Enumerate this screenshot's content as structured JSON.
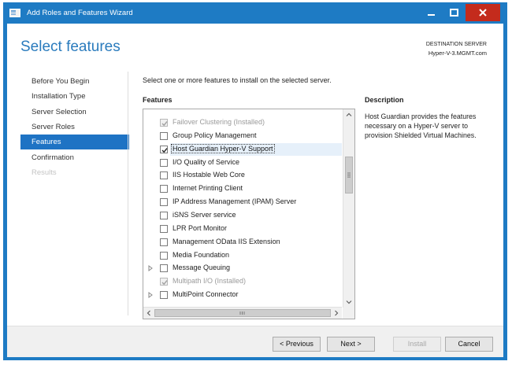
{
  "window": {
    "title": "Add Roles and Features Wizard",
    "accent_color": "#1e7bc4",
    "close_color": "#c42b1c"
  },
  "header": {
    "heading": "Select features",
    "destination_label": "DESTINATION SERVER",
    "destination_value": "Hyper-V-3.MGMT.com"
  },
  "nav": {
    "items": [
      {
        "label": "Before You Begin",
        "state": "normal"
      },
      {
        "label": "Installation Type",
        "state": "normal"
      },
      {
        "label": "Server Selection",
        "state": "normal"
      },
      {
        "label": "Server Roles",
        "state": "normal"
      },
      {
        "label": "Features",
        "state": "selected"
      },
      {
        "label": "Confirmation",
        "state": "normal"
      },
      {
        "label": "Results",
        "state": "disabled"
      }
    ]
  },
  "main": {
    "instruction": "Select one or more features to install on the selected server.",
    "features_label": "Features",
    "features": [
      {
        "label": "Failover Clustering (Installed)",
        "checked": true,
        "disabled": true,
        "expander": false,
        "selected": false
      },
      {
        "label": "Group Policy Management",
        "checked": false,
        "disabled": false,
        "expander": false,
        "selected": false
      },
      {
        "label": "Host Guardian Hyper-V Support",
        "checked": true,
        "disabled": false,
        "expander": false,
        "selected": true
      },
      {
        "label": "I/O Quality of Service",
        "checked": false,
        "disabled": false,
        "expander": false,
        "selected": false
      },
      {
        "label": "IIS Hostable Web Core",
        "checked": false,
        "disabled": false,
        "expander": false,
        "selected": false
      },
      {
        "label": "Internet Printing Client",
        "checked": false,
        "disabled": false,
        "expander": false,
        "selected": false
      },
      {
        "label": "IP Address Management (IPAM) Server",
        "checked": false,
        "disabled": false,
        "expander": false,
        "selected": false
      },
      {
        "label": "iSNS Server service",
        "checked": false,
        "disabled": false,
        "expander": false,
        "selected": false
      },
      {
        "label": "LPR Port Monitor",
        "checked": false,
        "disabled": false,
        "expander": false,
        "selected": false
      },
      {
        "label": "Management OData IIS Extension",
        "checked": false,
        "disabled": false,
        "expander": false,
        "selected": false
      },
      {
        "label": "Media Foundation",
        "checked": false,
        "disabled": false,
        "expander": false,
        "selected": false
      },
      {
        "label": "Message Queuing",
        "checked": false,
        "disabled": false,
        "expander": true,
        "selected": false
      },
      {
        "label": "Multipath I/O (Installed)",
        "checked": true,
        "disabled": true,
        "expander": false,
        "selected": false
      },
      {
        "label": "MultiPoint Connector",
        "checked": false,
        "disabled": false,
        "expander": true,
        "selected": false
      }
    ],
    "description_label": "Description",
    "description_text": "Host Guardian provides the features necessary on a Hyper-V server to provision Shielded Virtual Machines."
  },
  "footer": {
    "previous_label": "< Previous",
    "next_label": "Next >",
    "install_label": "Install",
    "cancel_label": "Cancel"
  }
}
